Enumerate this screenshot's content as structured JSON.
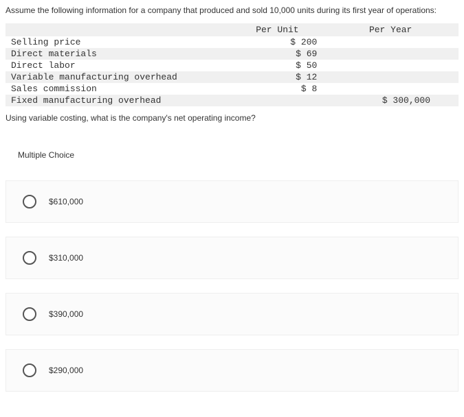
{
  "intro": "Assume the following information for a company that produced and sold 10,000 units during its first year of operations:",
  "table": {
    "headers": {
      "per_unit": "Per Unit",
      "per_year": "Per Year"
    },
    "rows": [
      {
        "label": "Selling price",
        "per_unit": "$ 200",
        "per_year": ""
      },
      {
        "label": "Direct materials",
        "per_unit": "$ 69",
        "per_year": ""
      },
      {
        "label": "Direct labor",
        "per_unit": "$ 50",
        "per_year": ""
      },
      {
        "label": "Variable manufacturing overhead",
        "per_unit": "$ 12",
        "per_year": ""
      },
      {
        "label": "Sales commission",
        "per_unit": "$ 8",
        "per_year": ""
      },
      {
        "label": "Fixed manufacturing overhead",
        "per_unit": "",
        "per_year": "$ 300,000"
      }
    ]
  },
  "question": "Using variable costing, what is the company's net operating income?",
  "mc_heading": "Multiple Choice",
  "choices": [
    {
      "label": "$610,000"
    },
    {
      "label": "$310,000"
    },
    {
      "label": "$390,000"
    },
    {
      "label": "$290,000"
    }
  ]
}
